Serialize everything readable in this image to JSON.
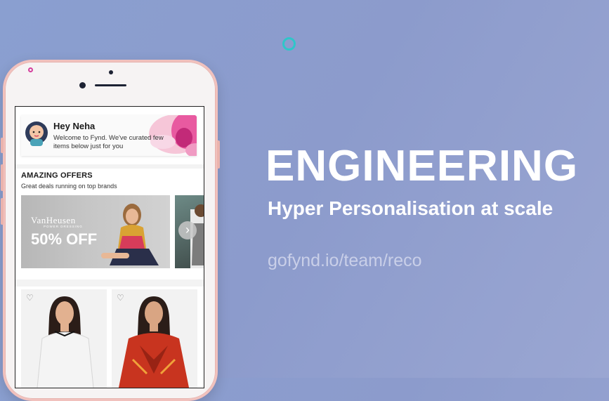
{
  "greeting": {
    "title": "Hey Neha",
    "message": "Welcome to Fynd. We've curated few items below just for you"
  },
  "offers": {
    "title": "AMAZING OFFERS",
    "subtitle": "Great deals running on top brands",
    "banner": {
      "brand": "VanHeusen",
      "brand_sub": "POWER DRESSING",
      "discount": "50% OFF"
    }
  },
  "products": [
    {
      "icon": "heart-icon"
    },
    {
      "icon": "heart-icon"
    }
  ],
  "hero": {
    "title": "ENGINEERING",
    "subtitle": "Hyper Personalisation at scale",
    "url": "gofynd.io/team/reco"
  },
  "colors": {
    "background": "#8c9bcc",
    "accent_teal": "#2ec6c9",
    "phone_frame": "#f1c1bd"
  }
}
